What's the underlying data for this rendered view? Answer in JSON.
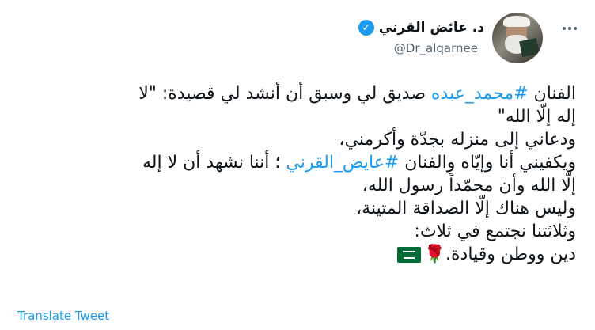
{
  "author": {
    "display_name": "د. عائض القرني",
    "handle": "@Dr_alqarnee",
    "verified_icon": "✓"
  },
  "tweet": {
    "line1_before": "الفنان ",
    "hashtag1": "#محمد_عبده",
    "line1_after": " صديق لي وسبق أن أنشد لي قصيدة: \"لا",
    "line2": "إله إلّا الله\"",
    "line3": "ودعاني إلى منزله بجدّة وأكرمني،",
    "line4_before": "ويكفيني أنا وإيّاه والفنان ",
    "hashtag2": "#عايض_القرني",
    "line4_after": " ؛ أننا نشهد أن لا إله",
    "line5": "إلّا الله وأن محمّداً رسول الله،",
    "line6": "وليس هناك إلّا الصداقة المتينة،",
    "line7": "وثلاثتنا نجتمع في ثلاث:",
    "line8": "دين ووطن وقيادة.",
    "rose_emoji": "🌹"
  },
  "translate_label": "Translate Tweet",
  "colors": {
    "link": "#1d9bf0",
    "text": "#0f1419",
    "secondary": "#536471",
    "flag_green": "#006c35"
  }
}
